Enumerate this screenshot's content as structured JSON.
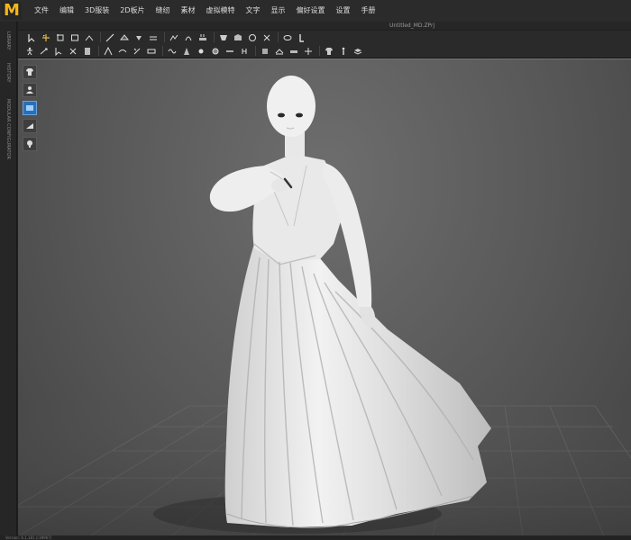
{
  "app": {
    "logo_letter": "M",
    "accent_color": "#f3b61c"
  },
  "menu": {
    "items": [
      "文件",
      "编辑",
      "3D服装",
      "2D板片",
      "缝纫",
      "素材",
      "虚拟模特",
      "文字",
      "显示",
      "偏好设置",
      "设置",
      "手册"
    ]
  },
  "document": {
    "title": "Untitled_MD.ZPrj"
  },
  "left_tabs": [
    "LIBRARY",
    "HISTORY",
    "MODULAR CONFIGURATOR"
  ],
  "toolbar_row_1_icons": [
    "transform-pattern-icon",
    "select-move-icon",
    "select-mesh-icon",
    "edit-box-icon",
    "fold-icon",
    "line-icon",
    "tack-icon",
    "pin-icon",
    "flatten-icon",
    "puckering-icon",
    "bend-icon",
    "steam-icon",
    "shape-icon",
    "fabric-icon",
    "button-icon",
    "zipper-icon",
    "tape-icon",
    "measure-icon"
  ],
  "toolbar_row_2_icons": [
    "avatar-walk-icon",
    "simulate-icon",
    "select-icon",
    "cut-icon",
    "sew-icon",
    "fold-arrange-icon",
    "garment-fit-icon",
    "edit-sewing-icon",
    "line-sew-icon",
    "free-sew-icon",
    "dart-icon",
    "point-icon",
    "circle-point-icon",
    "line-tool-icon",
    "pleat-icon",
    "seam-icon",
    "sleeve-icon",
    "flat-icon",
    "align-icon",
    "shirt-icon",
    "avatar-pose-icon",
    "stack-icon"
  ],
  "viewport_tools": [
    "garment-view-icon",
    "avatar-view-icon",
    "texture-view-icon",
    "mesh-view-icon",
    "light-icon"
  ],
  "status": {
    "text": "Version: 6.1.181 (r39967)"
  }
}
